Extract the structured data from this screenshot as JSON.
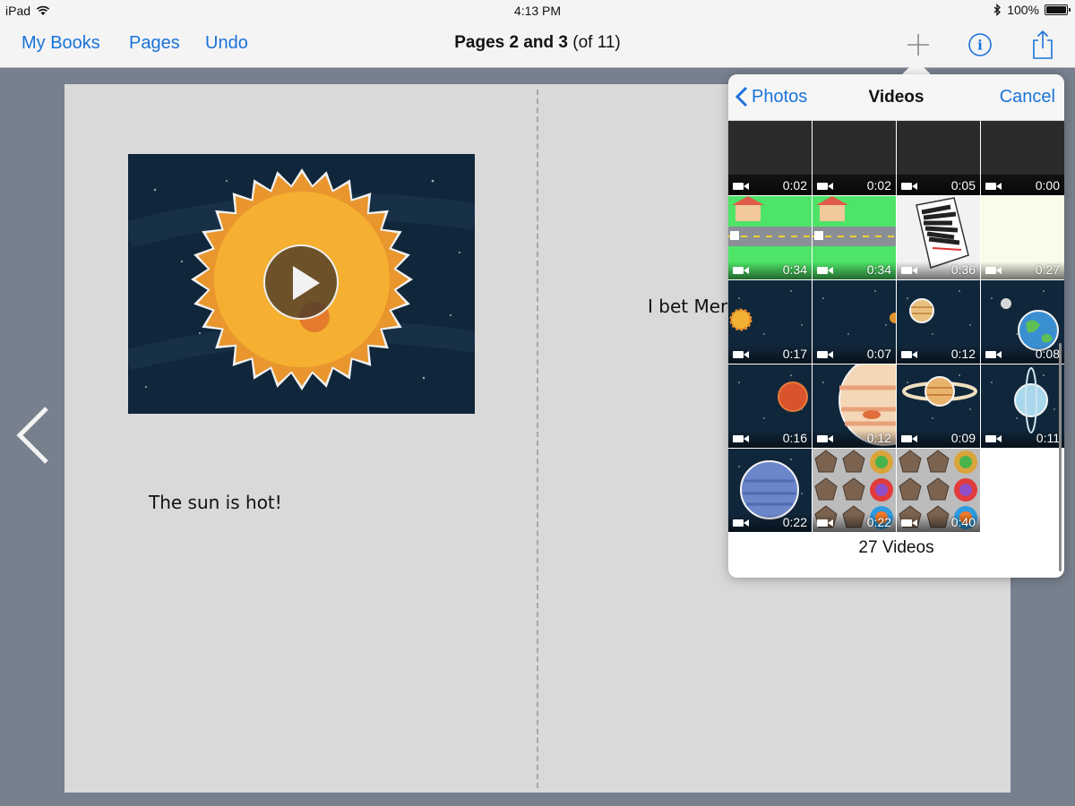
{
  "status_bar": {
    "device": "iPad",
    "time": "4:13 PM",
    "battery": "100%"
  },
  "toolbar": {
    "my_books": "My Books",
    "pages": "Pages",
    "undo": "Undo",
    "title_bold": "Pages 2 and 3",
    "title_suffix": "(of 11)",
    "icons": [
      "add-icon",
      "info-icon",
      "share-icon"
    ]
  },
  "book": {
    "left_caption": "The sun is hot!",
    "right_caption": "I bet Merc"
  },
  "popover": {
    "back_label": "Photos",
    "title": "Videos",
    "cancel_label": "Cancel",
    "count_label": "27 Videos",
    "videos": [
      {
        "duration": "0:02",
        "thumb": "dark"
      },
      {
        "duration": "0:02",
        "thumb": "dark"
      },
      {
        "duration": "0:05",
        "thumb": "dark"
      },
      {
        "duration": "0:00",
        "thumb": "dark"
      },
      {
        "duration": "0:34",
        "thumb": "house-road"
      },
      {
        "duration": "0:34",
        "thumb": "house-road"
      },
      {
        "duration": "0:36",
        "thumb": "drawing"
      },
      {
        "duration": "0:27",
        "thumb": "cream"
      },
      {
        "duration": "0:17",
        "thumb": "sun"
      },
      {
        "duration": "0:07",
        "thumb": "small-planet-edge"
      },
      {
        "duration": "0:12",
        "thumb": "venus"
      },
      {
        "duration": "0:08",
        "thumb": "earth-moon"
      },
      {
        "duration": "0:16",
        "thumb": "mars"
      },
      {
        "duration": "0:12",
        "thumb": "jupiter"
      },
      {
        "duration": "0:09",
        "thumb": "saturn"
      },
      {
        "duration": "0:11",
        "thumb": "uranus"
      },
      {
        "duration": "0:22",
        "thumb": "neptune"
      },
      {
        "duration": "0:22",
        "thumb": "umbrellas"
      },
      {
        "duration": "0:40",
        "thumb": "umbrellas"
      }
    ]
  }
}
